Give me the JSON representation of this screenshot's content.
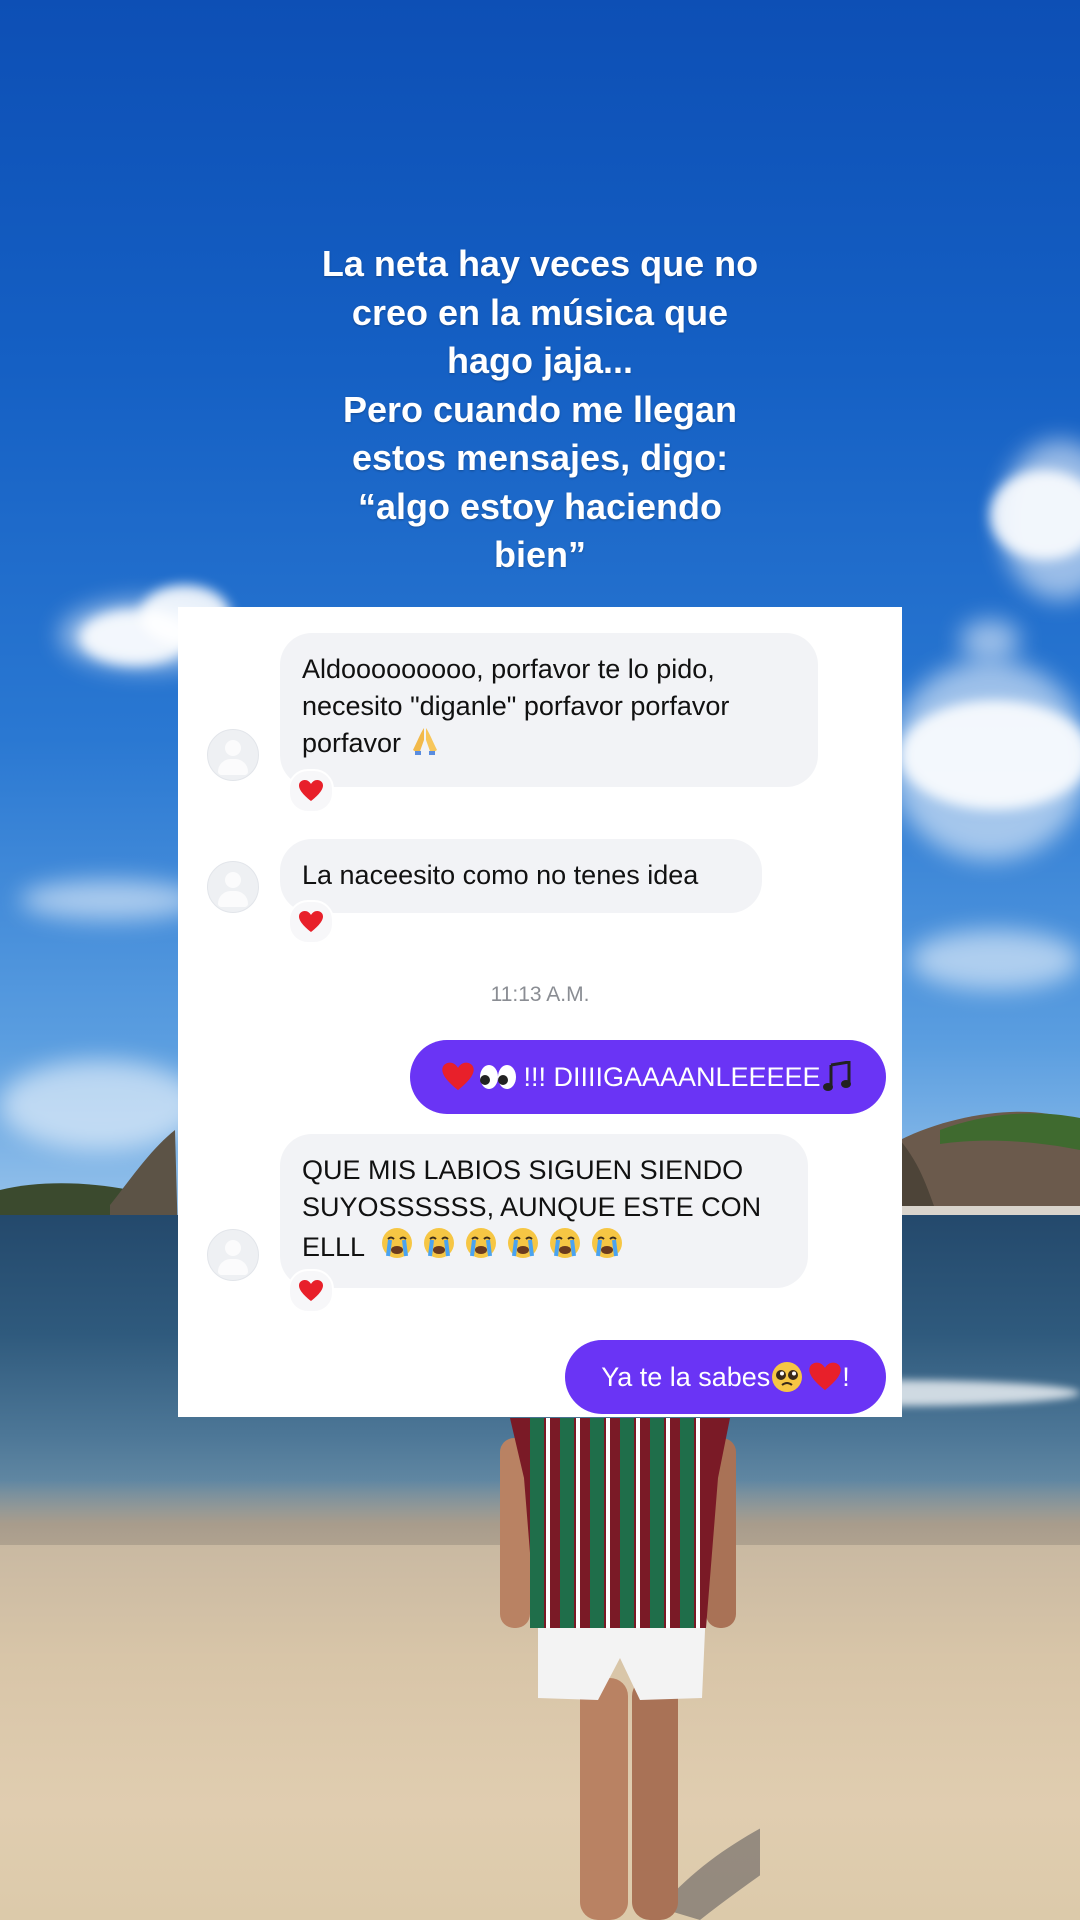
{
  "caption": {
    "lines": [
      "La neta hay veces que no",
      "creo en la música que",
      "hago jaja...",
      "Pero cuando me llegan",
      "estos mensajes, digo:",
      "“algo estoy haciendo",
      "bien”"
    ]
  },
  "chat": {
    "messages": [
      {
        "direction": "incoming",
        "lines": [
          "Aldooooooooo, porfavor te lo pido,",
          "necesito \"diganle\" porfavor porfavor",
          "porfavor"
        ],
        "trailing_emoji": "folded-hands",
        "reaction": "red-heart"
      },
      {
        "direction": "incoming",
        "lines": [
          "La naceesito como no tenes idea"
        ],
        "reaction": "red-heart"
      },
      {
        "direction": "outgoing",
        "prefix_emojis": [
          "red-heart",
          "eyes"
        ],
        "text": "!!! DIIIIGAAAANLEEEEE",
        "suffix_emoji": "musical-notes"
      },
      {
        "direction": "incoming",
        "lines": [
          "QUE MIS LABIOS SIGUEN SIENDO",
          "SUYOSSSSSS, AUNQUE ESTE CON",
          "ELLL"
        ],
        "trailing_emojis": [
          "loudly-crying-face",
          "loudly-crying-face",
          "loudly-crying-face",
          "loudly-crying-face",
          "loudly-crying-face",
          "loudly-crying-face"
        ],
        "reaction": "red-heart"
      },
      {
        "direction": "outgoing",
        "text": "Ya te la sabes",
        "suffix_emojis": [
          "pleading-face",
          "red-heart"
        ],
        "suffix_text": "!"
      }
    ],
    "timestamp": "11:13 A.M."
  },
  "colors": {
    "outgoing_bubble": "#6a34f5",
    "incoming_bubble": "#f2f3f6",
    "heart": "#e8202a",
    "timestamp": "#8a8d93"
  }
}
